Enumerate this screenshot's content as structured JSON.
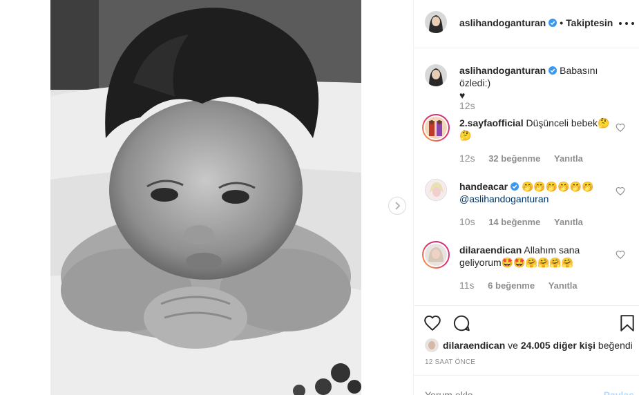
{
  "post": {
    "username": "aslihandoganturan",
    "follow_status": "Takiptesin",
    "separator": "•"
  },
  "caption": {
    "username": "aslihandoganturan",
    "text": "Babasını özledi:)",
    "line2": "♥",
    "time": "12s"
  },
  "comments": [
    {
      "username": "2.sayfaofficial",
      "text": "Düşünceli bebek🤔🤔",
      "time": "12s",
      "likes": "32 beğenme",
      "reply": "Yanıtla"
    },
    {
      "username": "handeacar",
      "text": "🤭🤭🤭🤭🤭🤭",
      "mention": "@aslihandoganturan",
      "time": "10s",
      "likes": "14 beğenme",
      "reply": "Yanıtla"
    },
    {
      "username": "dilaraendican",
      "text": "Allahım sana geliyorum🤩🤩🤗🤗🤗🤗",
      "time": "11s",
      "likes": "6 beğenme",
      "reply": "Yanıtla"
    }
  ],
  "liked_by": {
    "user": "dilaraendican",
    "connector": "ve",
    "others": "24.005 diğer kişi",
    "suffix": "beğendi"
  },
  "time_ago": "12 SAAT ÖNCE",
  "add_comment": {
    "placeholder": "Yorum ekle...",
    "share_label": "Paylaş"
  },
  "colors": {
    "verified": "#3897f0",
    "text": "#262626",
    "muted": "#8e8e8e",
    "share_disabled": "#b3dbff"
  }
}
